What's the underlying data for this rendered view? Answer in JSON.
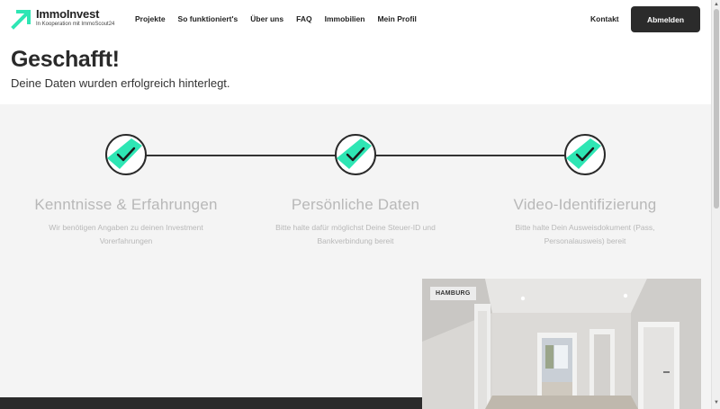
{
  "brand": {
    "name": "ImmoInvest",
    "tagline": "In Kooperation mit ImmoScout24",
    "accent_color": "#2ee6b4"
  },
  "nav": {
    "items": [
      {
        "label": "Projekte"
      },
      {
        "label": "So funktioniert's"
      },
      {
        "label": "Über uns"
      },
      {
        "label": "FAQ"
      },
      {
        "label": "Immobilien"
      },
      {
        "label": "Mein Profil"
      }
    ],
    "contact_label": "Kontakt",
    "logout_label": "Abmelden"
  },
  "hero": {
    "title": "Geschafft!",
    "subtitle": "Deine Daten wurden erfolgreich hinterlegt."
  },
  "steps": [
    {
      "title": "Kenntnisse & Erfahrungen",
      "description": "Wir benötigen Angaben zu deinen Investment Vorerfahrungen",
      "icon": "check-icon"
    },
    {
      "title": "Persönliche Daten",
      "description": "Bitte halte dafür möglichst Deine Steuer-ID und Bankverbindung bereit",
      "icon": "check-icon"
    },
    {
      "title": "Video-Identifizierung",
      "description": "Bitte halte Dein Ausweisdokument (Pass, Personalausweis) bereit",
      "icon": "check-icon"
    }
  ],
  "project_card": {
    "badge": "HAMBURG"
  }
}
